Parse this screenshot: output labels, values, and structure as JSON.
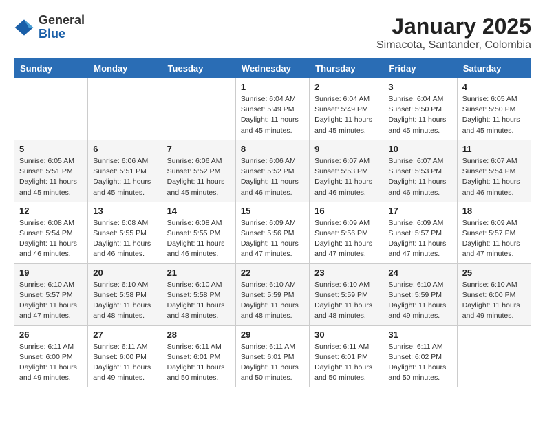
{
  "header": {
    "logo_general": "General",
    "logo_blue": "Blue",
    "title": "January 2025",
    "subtitle": "Simacota, Santander, Colombia"
  },
  "days_of_week": [
    "Sunday",
    "Monday",
    "Tuesday",
    "Wednesday",
    "Thursday",
    "Friday",
    "Saturday"
  ],
  "weeks": [
    [
      {
        "day": "",
        "info": ""
      },
      {
        "day": "",
        "info": ""
      },
      {
        "day": "",
        "info": ""
      },
      {
        "day": "1",
        "info": "Sunrise: 6:04 AM\nSunset: 5:49 PM\nDaylight: 11 hours and 45 minutes."
      },
      {
        "day": "2",
        "info": "Sunrise: 6:04 AM\nSunset: 5:49 PM\nDaylight: 11 hours and 45 minutes."
      },
      {
        "day": "3",
        "info": "Sunrise: 6:04 AM\nSunset: 5:50 PM\nDaylight: 11 hours and 45 minutes."
      },
      {
        "day": "4",
        "info": "Sunrise: 6:05 AM\nSunset: 5:50 PM\nDaylight: 11 hours and 45 minutes."
      }
    ],
    [
      {
        "day": "5",
        "info": "Sunrise: 6:05 AM\nSunset: 5:51 PM\nDaylight: 11 hours and 45 minutes."
      },
      {
        "day": "6",
        "info": "Sunrise: 6:06 AM\nSunset: 5:51 PM\nDaylight: 11 hours and 45 minutes."
      },
      {
        "day": "7",
        "info": "Sunrise: 6:06 AM\nSunset: 5:52 PM\nDaylight: 11 hours and 45 minutes."
      },
      {
        "day": "8",
        "info": "Sunrise: 6:06 AM\nSunset: 5:52 PM\nDaylight: 11 hours and 46 minutes."
      },
      {
        "day": "9",
        "info": "Sunrise: 6:07 AM\nSunset: 5:53 PM\nDaylight: 11 hours and 46 minutes."
      },
      {
        "day": "10",
        "info": "Sunrise: 6:07 AM\nSunset: 5:53 PM\nDaylight: 11 hours and 46 minutes."
      },
      {
        "day": "11",
        "info": "Sunrise: 6:07 AM\nSunset: 5:54 PM\nDaylight: 11 hours and 46 minutes."
      }
    ],
    [
      {
        "day": "12",
        "info": "Sunrise: 6:08 AM\nSunset: 5:54 PM\nDaylight: 11 hours and 46 minutes."
      },
      {
        "day": "13",
        "info": "Sunrise: 6:08 AM\nSunset: 5:55 PM\nDaylight: 11 hours and 46 minutes."
      },
      {
        "day": "14",
        "info": "Sunrise: 6:08 AM\nSunset: 5:55 PM\nDaylight: 11 hours and 46 minutes."
      },
      {
        "day": "15",
        "info": "Sunrise: 6:09 AM\nSunset: 5:56 PM\nDaylight: 11 hours and 47 minutes."
      },
      {
        "day": "16",
        "info": "Sunrise: 6:09 AM\nSunset: 5:56 PM\nDaylight: 11 hours and 47 minutes."
      },
      {
        "day": "17",
        "info": "Sunrise: 6:09 AM\nSunset: 5:57 PM\nDaylight: 11 hours and 47 minutes."
      },
      {
        "day": "18",
        "info": "Sunrise: 6:09 AM\nSunset: 5:57 PM\nDaylight: 11 hours and 47 minutes."
      }
    ],
    [
      {
        "day": "19",
        "info": "Sunrise: 6:10 AM\nSunset: 5:57 PM\nDaylight: 11 hours and 47 minutes."
      },
      {
        "day": "20",
        "info": "Sunrise: 6:10 AM\nSunset: 5:58 PM\nDaylight: 11 hours and 48 minutes."
      },
      {
        "day": "21",
        "info": "Sunrise: 6:10 AM\nSunset: 5:58 PM\nDaylight: 11 hours and 48 minutes."
      },
      {
        "day": "22",
        "info": "Sunrise: 6:10 AM\nSunset: 5:59 PM\nDaylight: 11 hours and 48 minutes."
      },
      {
        "day": "23",
        "info": "Sunrise: 6:10 AM\nSunset: 5:59 PM\nDaylight: 11 hours and 48 minutes."
      },
      {
        "day": "24",
        "info": "Sunrise: 6:10 AM\nSunset: 5:59 PM\nDaylight: 11 hours and 49 minutes."
      },
      {
        "day": "25",
        "info": "Sunrise: 6:10 AM\nSunset: 6:00 PM\nDaylight: 11 hours and 49 minutes."
      }
    ],
    [
      {
        "day": "26",
        "info": "Sunrise: 6:11 AM\nSunset: 6:00 PM\nDaylight: 11 hours and 49 minutes."
      },
      {
        "day": "27",
        "info": "Sunrise: 6:11 AM\nSunset: 6:00 PM\nDaylight: 11 hours and 49 minutes."
      },
      {
        "day": "28",
        "info": "Sunrise: 6:11 AM\nSunset: 6:01 PM\nDaylight: 11 hours and 50 minutes."
      },
      {
        "day": "29",
        "info": "Sunrise: 6:11 AM\nSunset: 6:01 PM\nDaylight: 11 hours and 50 minutes."
      },
      {
        "day": "30",
        "info": "Sunrise: 6:11 AM\nSunset: 6:01 PM\nDaylight: 11 hours and 50 minutes."
      },
      {
        "day": "31",
        "info": "Sunrise: 6:11 AM\nSunset: 6:02 PM\nDaylight: 11 hours and 50 minutes."
      },
      {
        "day": "",
        "info": ""
      }
    ]
  ]
}
